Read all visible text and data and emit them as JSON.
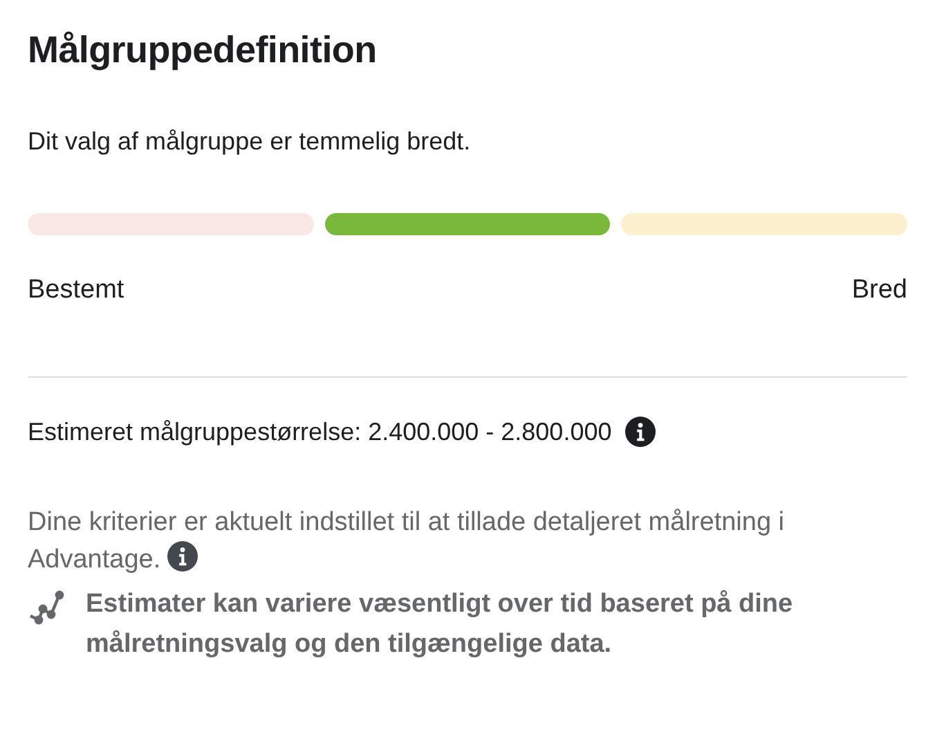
{
  "title": "Målgruppedefinition",
  "summary": "Dit valg af målgruppe er temmelig bredt.",
  "meter": {
    "segments": [
      {
        "color": "#f9e8e4"
      },
      {
        "color": "#79b83a"
      },
      {
        "color": "#fdf0cf"
      }
    ],
    "min_label": "Bestemt",
    "max_label": "Bred"
  },
  "estimate": {
    "label": "Estimeret målgruppestørrelse: 2.400.000 - 2.800.000"
  },
  "note": "Dine kriterier er aktuelt indstillet til at tillade detaljeret målretning i Advantage.",
  "disclaimer": "Estimater kan variere væsentligt over tid baseret på dine målretningsvalg og den tilgængelige data."
}
